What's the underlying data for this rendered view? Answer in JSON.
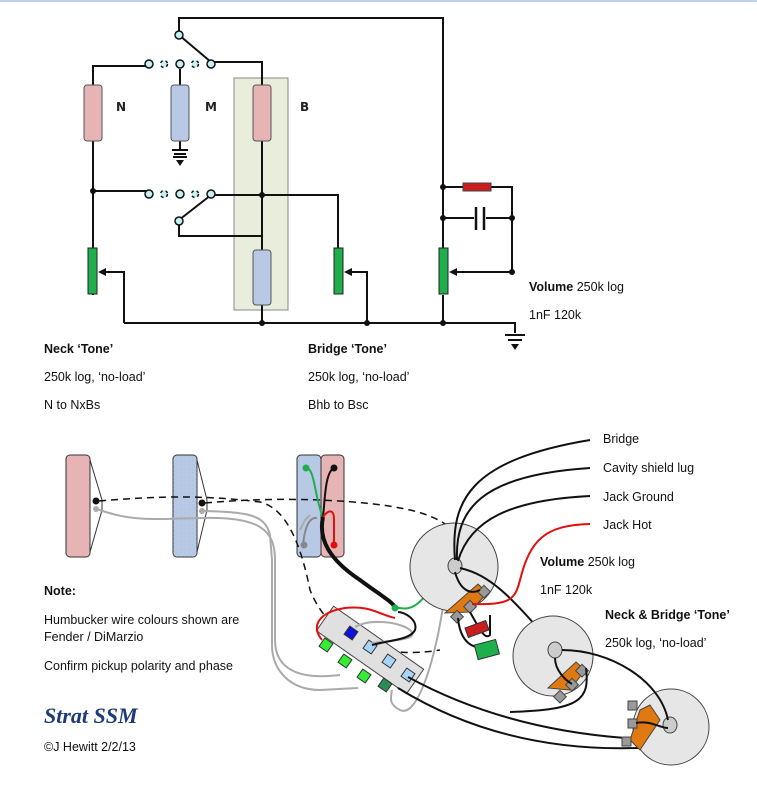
{
  "title": "Strat SSM",
  "copyright": "©J Hewitt 2/2/13",
  "schematic": {
    "pickup_labels": [
      "N",
      "M",
      "B"
    ],
    "neck_tone": {
      "heading": "Neck ‘Tone’",
      "line1": "250k log, ‘no-load’",
      "line2": "N to NxBs"
    },
    "bridge_tone": {
      "heading": "Bridge ‘Tone’",
      "line1": "250k log, ‘no-load’",
      "line2": "Bhb to Bsc"
    },
    "volume": {
      "heading": "Volume",
      "value": "250k log",
      "line2": "1nF 120k"
    }
  },
  "wiring": {
    "connections": [
      "Bridge",
      "Cavity shield lug",
      "Jack Ground",
      "Jack Hot"
    ],
    "volume": {
      "heading": "Volume",
      "value": "250k log",
      "line2": "1nF 120k"
    },
    "tone": {
      "heading": "Neck & Bridge ‘Tone’",
      "line1": "250k log, ‘no-load’"
    }
  },
  "note": {
    "heading": "Note:",
    "line1": "Humbucker wire colours shown are",
    "line2": "Fender / DiMarzio",
    "line3": "Confirm pickup polarity and phase"
  },
  "colors": {
    "single_coil_pink": "#e6b4b4",
    "single_coil_blue": "#b8c9e6",
    "pot_green": "#1fae4c",
    "resistor_red": "#c81e1e",
    "switch_node": "#c8f0f0",
    "bucker_box": "#e9eedc",
    "pot_body": "#e6e6e6",
    "pot_lug_orange": "#e07a10",
    "title_blue": "#1f3a78"
  }
}
